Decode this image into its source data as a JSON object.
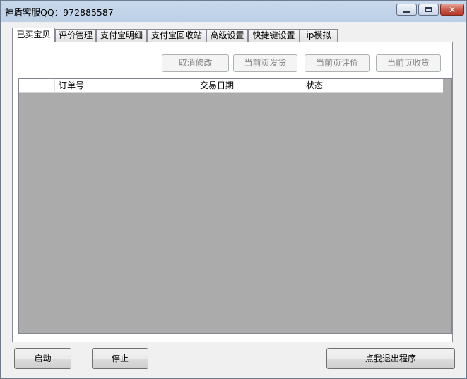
{
  "window": {
    "title": "神盾客服QQ：972885587"
  },
  "tabs": [
    {
      "label": "已买宝贝",
      "active": true
    },
    {
      "label": "评价管理",
      "active": false
    },
    {
      "label": "支付宝明细",
      "active": false
    },
    {
      "label": "支付宝回收站",
      "active": false
    },
    {
      "label": "高级设置",
      "active": false
    },
    {
      "label": "快捷键设置",
      "active": false
    },
    {
      "label": "ip模拟",
      "active": false
    }
  ],
  "actions": {
    "cancel_edit": "取消修改",
    "ship_page": "当前页发货",
    "review_page": "当前页评价",
    "receive_page": "当前页收货"
  },
  "table": {
    "columns": [
      "",
      "订单号",
      "交易日期",
      "状态"
    ],
    "rows": []
  },
  "footer": {
    "start": "启动",
    "stop": "停止",
    "exit": "点我退出程序"
  },
  "icons": {
    "minimize": "minimize-icon",
    "maximize": "maximize-icon",
    "close": "close-icon"
  }
}
